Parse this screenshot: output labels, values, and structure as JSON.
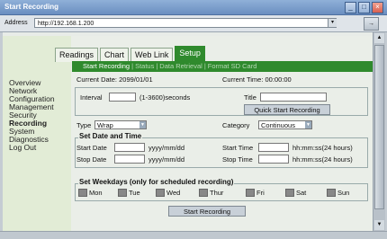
{
  "window": {
    "title": "Start Recording"
  },
  "browser": {
    "address_label": "Address",
    "url": "http://192.168.1.200"
  },
  "tabs": [
    "Readings",
    "Chart",
    "Web Link",
    "Setup"
  ],
  "subnav": [
    "Start Recording",
    "Status",
    "Data Retrieval",
    "Format SD Card"
  ],
  "sidenav": [
    "Overview",
    "Network",
    "Configuration",
    "Management",
    "Security",
    "Recording",
    "System",
    "Diagnostics",
    "Log Out"
  ],
  "info": {
    "current_date": "Current Date: 2099/01/01",
    "current_time": "Current Time: 00:00:00"
  },
  "interval": {
    "label": "Interval",
    "hint": "(1-3600)seconds"
  },
  "title_field": {
    "label": "Title"
  },
  "quick_start": "Quick Start Recording",
  "type": {
    "label": "Type",
    "value": "Wrap"
  },
  "category": {
    "label": "Category",
    "value": "Continuous"
  },
  "date_time": {
    "legend": "Set Date and Time",
    "start_date": "Start Date",
    "stop_date": "Stop Date",
    "date_fmt": "yyyy/mm/dd",
    "start_time": "Start Time",
    "stop_time": "Stop Time",
    "time_fmt": "hh:mm:ss(24 hours)"
  },
  "weekdays": {
    "legend": "Set Weekdays (only for scheduled recording)",
    "days": [
      "Mon",
      "Tue",
      "Wed",
      "Thur",
      "Fri",
      "Sat",
      "Sun"
    ]
  },
  "start_button": "Start Recording",
  "colors": {
    "accent": "#2f8a2d",
    "nav_bg": "#e2ecd6"
  }
}
